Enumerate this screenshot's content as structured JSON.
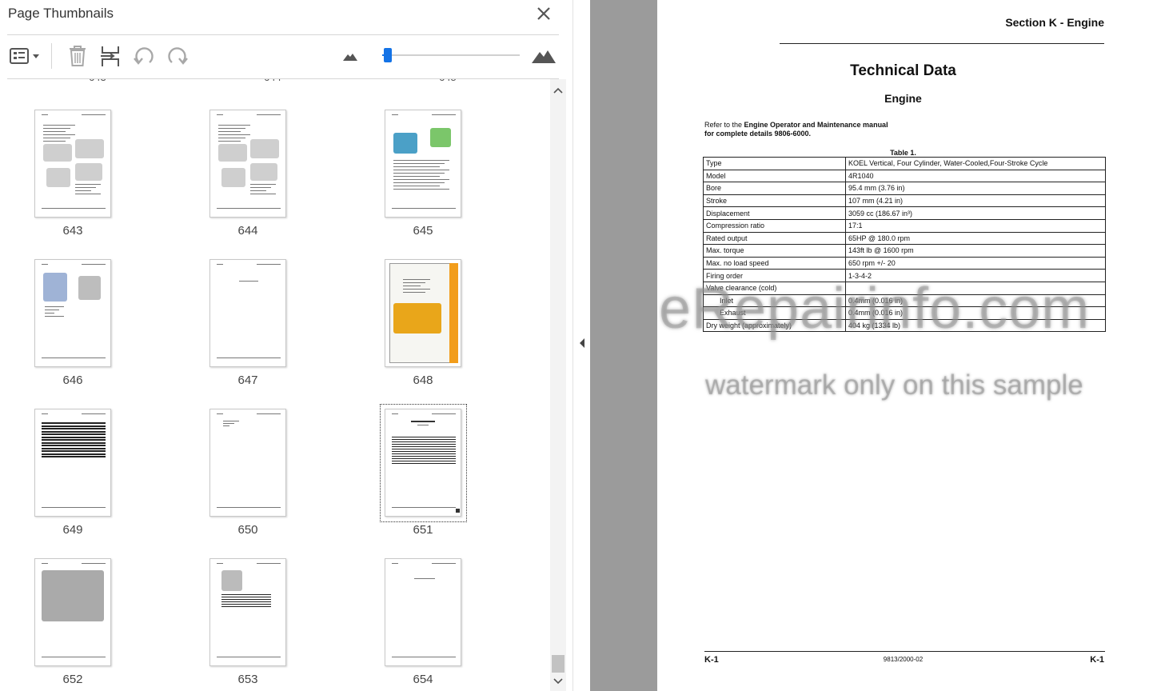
{
  "panel": {
    "title": "Page Thumbnails",
    "partial_labels": [
      "643",
      "644",
      "645"
    ],
    "thumbnails": [
      {
        "page": "643"
      },
      {
        "page": "644"
      },
      {
        "page": "645"
      },
      {
        "page": "646"
      },
      {
        "page": "647"
      },
      {
        "page": "648"
      },
      {
        "page": "649"
      },
      {
        "page": "650"
      },
      {
        "page": "651",
        "selected": true
      },
      {
        "page": "652"
      },
      {
        "page": "653"
      },
      {
        "page": "654"
      }
    ],
    "zoom_slider_value": 0.02,
    "icons": {
      "close": "close-icon",
      "options": "thumbnail-options-icon",
      "delete": "trash-icon",
      "insert": "insert-page-icon",
      "rotate_ccw": "rotate-counterclockwise-icon",
      "rotate_cw": "rotate-clockwise-icon",
      "zoom_out": "mountain-small-icon",
      "zoom_in": "mountain-large-icon"
    }
  },
  "document": {
    "section_header": "Section K - Engine",
    "title": "Technical Data",
    "subtitle": "Engine",
    "reference_prefix": "Refer to the ",
    "reference_bold": "Engine Operator and Maintenance manual",
    "reference_line2": "for complete details 9806-6000.",
    "table_caption": "Table 1.",
    "table": [
      {
        "label": "Type",
        "value": "KOEL Vertical, Four Cylinder, Water-Cooled,Four-Stroke Cycle"
      },
      {
        "label": "Model",
        "value": "4R1040"
      },
      {
        "label": "Bore",
        "value": "95.4 mm (3.76 in)"
      },
      {
        "label": "Stroke",
        "value": "107 mm (4.21 in)"
      },
      {
        "label": "Displacement",
        "value": "3059 cc (186.67 in³)"
      },
      {
        "label": "Compression ratio",
        "value": "17:1"
      },
      {
        "label": "Rated output",
        "value": "65HP @ 180.0 rpm"
      },
      {
        "label": "Max. torque",
        "value": "143ft lb @ 1600 rpm"
      },
      {
        "label": "Max. no load speed",
        "value": "650 rpm +/- 20"
      },
      {
        "label": "Firing order",
        "value": "1-3-4-2"
      },
      {
        "label": "Valve clearance (cold)",
        "value": ""
      },
      {
        "label": "Inlet",
        "value": "0.4mm (0.016 in)",
        "indent": true
      },
      {
        "label": "Exhaust",
        "value": "0.4mm (0.016 in)",
        "indent": true
      },
      {
        "label": "Dry weight (approximately)",
        "value": "404 kg (1334 lb)"
      }
    ],
    "footer_left": "K-1",
    "footer_center": "9813/2000-02",
    "footer_right": "K-1",
    "watermark_main": "eRepairinfo.com",
    "watermark_sub": "watermark only on this sample"
  }
}
